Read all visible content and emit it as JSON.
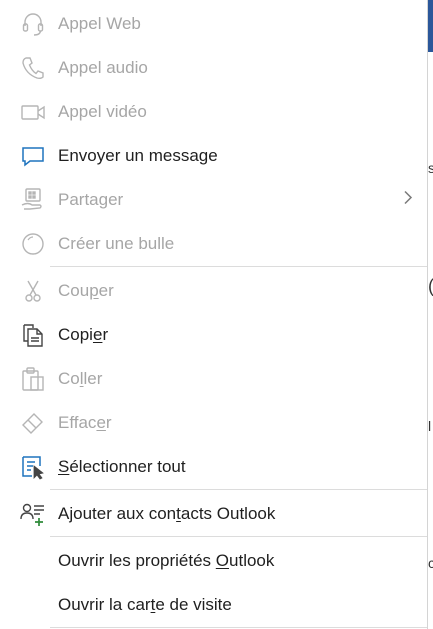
{
  "menu": {
    "items": [
      {
        "id": "web-call",
        "label": "Appel Web",
        "enabled": false,
        "icon": "headset-icon"
      },
      {
        "id": "audio-call",
        "label": "Appel audio",
        "enabled": false,
        "icon": "phone-icon"
      },
      {
        "id": "video-call",
        "label": "Appel vidéo",
        "enabled": false,
        "icon": "video-camera-icon"
      },
      {
        "id": "send-message",
        "label": "Envoyer un message",
        "enabled": true,
        "icon": "chat-bubble-icon"
      },
      {
        "id": "share",
        "label": "Partager",
        "enabled": false,
        "icon": "share-screen-icon",
        "submenu": true
      },
      {
        "id": "create-bubble",
        "label": "Créer une bulle",
        "enabled": false,
        "icon": "bubble-icon"
      },
      {
        "id": "cut",
        "label_pre": "Cou",
        "label_mnemonic": "p",
        "label_post": "er",
        "label": "Couper",
        "enabled": false,
        "icon": "scissors-icon"
      },
      {
        "id": "copy",
        "label_pre": "Copi",
        "label_mnemonic": "e",
        "label_post": "r",
        "label": "Copier",
        "enabled": true,
        "icon": "copy-icon"
      },
      {
        "id": "paste",
        "label_pre": "Co",
        "label_mnemonic": "l",
        "label_post": "ler",
        "label": "Coller",
        "enabled": false,
        "icon": "clipboard-icon"
      },
      {
        "id": "clear",
        "label_pre": "Effac",
        "label_mnemonic": "e",
        "label_post": "r",
        "label": "Effacer",
        "enabled": false,
        "icon": "eraser-icon"
      },
      {
        "id": "select-all",
        "label_pre": "",
        "label_mnemonic": "S",
        "label_post": "électionner tout",
        "label": "Sélectionner tout",
        "enabled": true,
        "icon": "select-all-icon"
      },
      {
        "id": "add-contact",
        "label_pre": "Ajouter aux con",
        "label_mnemonic": "t",
        "label_post": "acts Outlook",
        "label": "Ajouter aux contacts Outlook",
        "enabled": true,
        "icon": "add-contact-icon"
      },
      {
        "id": "outlook-props",
        "label_pre": "Ouvrir les propriétés ",
        "label_mnemonic": "O",
        "label_post": "utlook",
        "label": "Ouvrir les propriétés Outlook",
        "enabled": true
      },
      {
        "id": "business-card",
        "label_pre": "Ouvrir la car",
        "label_mnemonic": "t",
        "label_post": "e de visite",
        "label": "Ouvrir la carte de visite",
        "enabled": true
      }
    ]
  },
  "colors": {
    "enabled_text": "#1f1f1f",
    "disabled_text": "#a6a6a6",
    "accent_blue": "#1e73be",
    "icon_dark": "#444444",
    "icon_disabled": "#b5b5b5",
    "add_green": "#2e8b3a"
  }
}
